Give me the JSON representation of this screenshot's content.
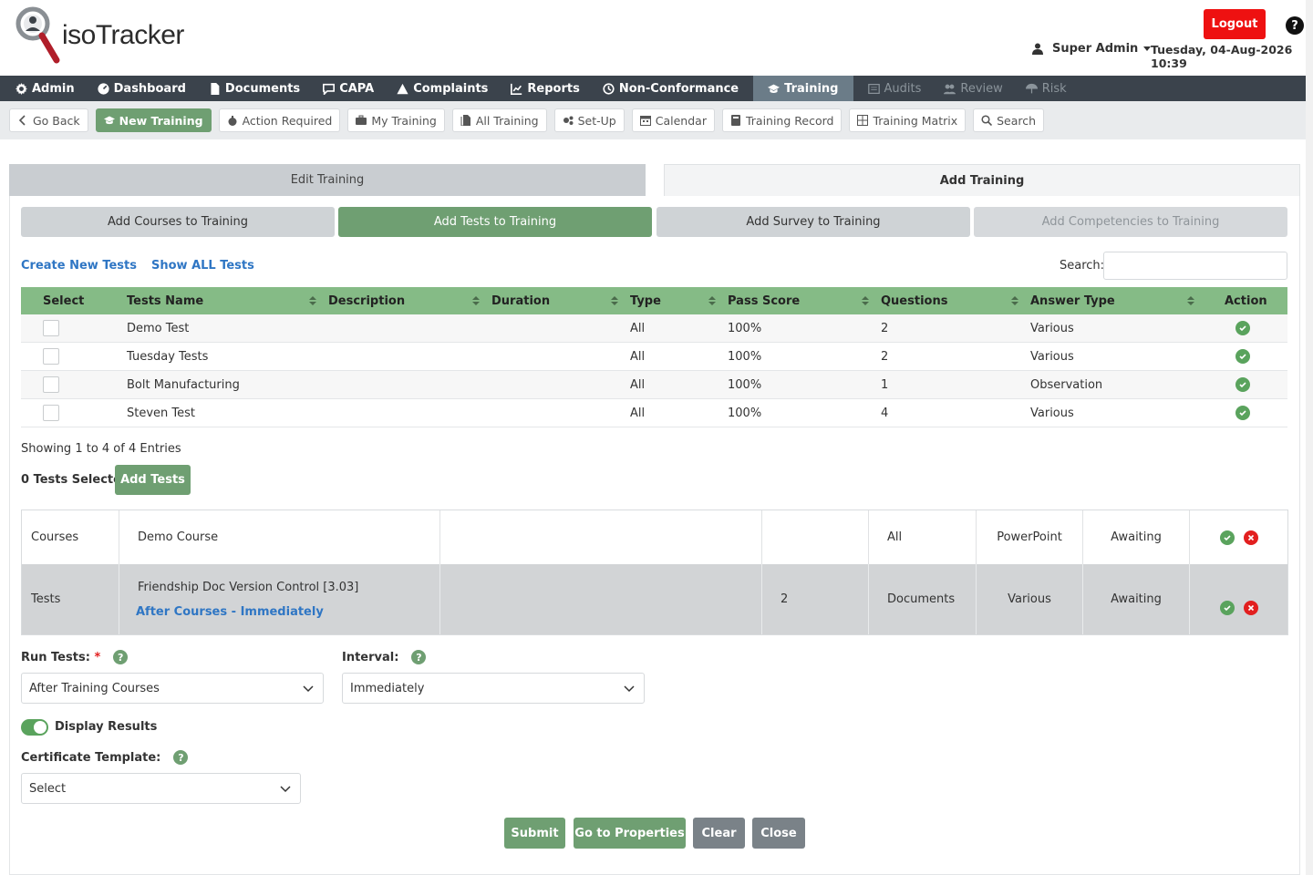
{
  "header": {
    "logo_text": "isoTracker",
    "logout_label": "Logout",
    "help_label": "?",
    "user_name": "Super Admin",
    "datetime": "Tuesday, 04-Aug-2026 10:39"
  },
  "mainnav": {
    "items": [
      {
        "label": "Admin",
        "icon": "gear-icon"
      },
      {
        "label": "Dashboard",
        "icon": "dashboard-icon"
      },
      {
        "label": "Documents",
        "icon": "document-icon"
      },
      {
        "label": "CAPA",
        "icon": "chat-icon"
      },
      {
        "label": "Complaints",
        "icon": "warning-icon"
      },
      {
        "label": "Reports",
        "icon": "chart-icon"
      },
      {
        "label": "Non-Conformance",
        "icon": "history-icon"
      },
      {
        "label": "Training",
        "icon": "graduation-icon"
      },
      {
        "label": "Audits",
        "icon": "list-icon"
      },
      {
        "label": "Review",
        "icon": "users-icon"
      },
      {
        "label": "Risk",
        "icon": "umbrella-icon"
      }
    ]
  },
  "subnav": {
    "items": [
      {
        "label": "Go Back",
        "icon": "chevron-left-icon"
      },
      {
        "label": "New Training",
        "icon": "graduation-icon"
      },
      {
        "label": "Action Required",
        "icon": "bomb-icon"
      },
      {
        "label": "My Training",
        "icon": "briefcase-icon"
      },
      {
        "label": "All Training",
        "icon": "files-icon"
      },
      {
        "label": "Set-Up",
        "icon": "cogs-icon"
      },
      {
        "label": "Calendar",
        "icon": "calendar-icon"
      },
      {
        "label": "Training Record",
        "icon": "book-icon"
      },
      {
        "label": "Training Matrix",
        "icon": "grid-icon"
      },
      {
        "label": "Search",
        "icon": "search-icon"
      }
    ]
  },
  "tabs": {
    "edit": "Edit Training",
    "add": "Add Training"
  },
  "subtabs": [
    "Add Courses to Training",
    "Add Tests to Training",
    "Add Survey to Training",
    "Add Competencies to Training"
  ],
  "links": {
    "create": "Create New Tests",
    "show_all": "Show ALL Tests"
  },
  "search": {
    "label": "Search:",
    "value": ""
  },
  "tests_table": {
    "headers": [
      "Select",
      "Tests Name",
      "Description",
      "Duration",
      "Type",
      "Pass Score",
      "Questions",
      "Answer Type",
      "Action"
    ],
    "rows": [
      {
        "name": "Demo Test",
        "description": "",
        "duration": "",
        "type": "All",
        "pass_score": "100%",
        "questions": "2",
        "answer_type": "Various"
      },
      {
        "name": "Tuesday Tests",
        "description": "",
        "duration": "",
        "type": "All",
        "pass_score": "100%",
        "questions": "2",
        "answer_type": "Various"
      },
      {
        "name": "Bolt Manufacturing",
        "description": "",
        "duration": "",
        "type": "All",
        "pass_score": "100%",
        "questions": "1",
        "answer_type": "Observation"
      },
      {
        "name": "Steven Test",
        "description": "",
        "duration": "",
        "type": "All",
        "pass_score": "100%",
        "questions": "4",
        "answer_type": "Various"
      }
    ],
    "showing": "Showing 1 to 4 of 4 Entries"
  },
  "selection": {
    "count_text": "0 Tests Selected",
    "add_button": "Add Tests"
  },
  "summary": {
    "rows": [
      {
        "category": "Courses",
        "name": "Demo Course",
        "sub": "",
        "col3": "",
        "col4": "",
        "col5": "All",
        "col6": "PowerPoint",
        "status": "Awaiting"
      },
      {
        "category": "Tests",
        "name": "Friendship Doc Version Control [3.03]",
        "sub": "After Courses - Immediately",
        "col3": "",
        "col4": "2",
        "col5": "Documents",
        "col6": "Various",
        "status": "Awaiting"
      }
    ]
  },
  "form": {
    "run_tests_label": "Run Tests:",
    "run_tests_required": "*",
    "run_tests_value": "After Training Courses",
    "interval_label": "Interval:",
    "interval_value": "Immediately",
    "display_results_label": "Display Results",
    "display_results_on": true,
    "certificate_label": "Certificate Template:",
    "certificate_value": "Select"
  },
  "buttons": {
    "submit": "Submit",
    "properties": "Go to Properties",
    "clear": "Clear",
    "close": "Close"
  },
  "colors": {
    "accent_green": "#6f9f72",
    "table_header": "#85bb86",
    "nav_bg": "#3b434c",
    "logout": "#ee1111",
    "link": "#2f76c4"
  }
}
